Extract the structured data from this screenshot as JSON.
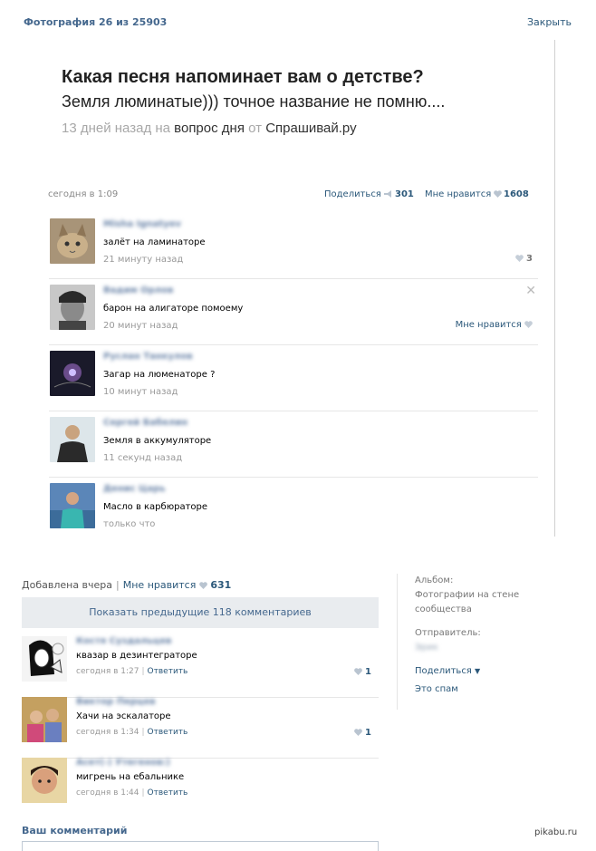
{
  "header": {
    "title": "Фотография 26 из 25903",
    "close": "Закрыть"
  },
  "question": {
    "title": "Какая песня напоминает вам о детстве?",
    "answer": "Земля люминатые))) точное название не помню....",
    "meta_prefix": "13 дней назад на",
    "meta_link": "вопрос дня",
    "meta_mid": "от",
    "meta_source": "Спрашивай.ру"
  },
  "post": {
    "date": "сегодня в 1:09",
    "share_label": "Поделиться",
    "share_count": "301",
    "like_label": "Мне нравится",
    "like_count": "1608"
  },
  "inner_comments": [
    {
      "name": "Misha Ignatyev",
      "text": "залёт на ламинаторе",
      "time": "21 минуту назад",
      "likes": "3"
    },
    {
      "name": "Вадим Орлов",
      "text": "барон на алигаторе помоему",
      "time": "20 минут назад",
      "like_label": "Мне нравится"
    },
    {
      "name": "Руслан Танкулов",
      "text": "Загар на люменаторе ?",
      "time": "10 минут назад"
    },
    {
      "name": "Сергей Бабелин",
      "text": "Земля в аккумуляторе",
      "time": "11 секунд назад"
    },
    {
      "name": "Денис Царь",
      "text": "Масло в карбюраторе",
      "time": "только что"
    }
  ],
  "bottom": {
    "added": "Добавлена вчера",
    "like_label": "Мне нравится",
    "like_count": "631",
    "show_prev": "Показать предыдущие 118 комментариев",
    "your_comment": "Ваш комментарий"
  },
  "comments": [
    {
      "name": "Костя Суздальцев",
      "text": "квазар в дезинтеграторе",
      "time": "сегодня в 1:27",
      "reply": "Ответить",
      "likes": "1"
    },
    {
      "name": "Виктор Перцев",
      "text": "Хачи на эскалаторе",
      "time": "сегодня в 1:34",
      "reply": "Ответить",
      "likes": "1"
    },
    {
      "name": "Асет(-) Утегенов:)",
      "text": "мигрень на ебальнике",
      "time": "сегодня в 1:44",
      "reply": "Ответить"
    }
  ],
  "sidebar": {
    "album_label": "Альбом:",
    "album_value": "Фотографии на стене сообщества",
    "sender_label": "Отправитель:",
    "sender_value": "Эрик",
    "share": "Поделиться",
    "spam": "Это спам"
  },
  "watermark": "pikabu.ru",
  "colors": {
    "link": "#2b587a",
    "header": "#45688e",
    "gray": "#999999",
    "button_bg": "#e9ecef"
  }
}
